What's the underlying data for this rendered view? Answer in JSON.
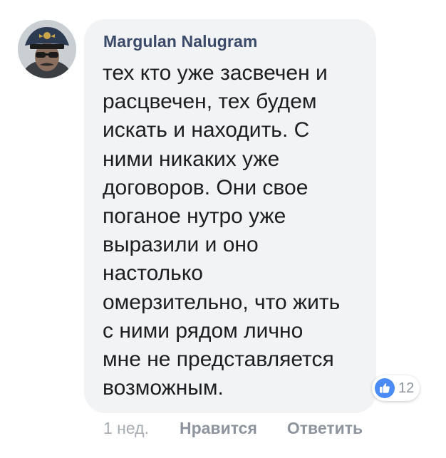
{
  "comment": {
    "author": "Margulan Nalugram",
    "text": "тех кто уже засвечен и\nрасцвечен, тех будем\nискать и находить. С\nними никаких уже\nдоговоров. Они свое\nпоганое нутро уже\nвыразили и оно\nнастолько\nомерзительно, что жить\nс ними рядом лично\nмне не представляется\nвозможным.",
    "reactions": {
      "icon": "thumbs-up-icon",
      "count": "12",
      "icon_color": "#4b8bf5"
    },
    "actions": {
      "timestamp": "1 нед.",
      "like_label": "Нравится",
      "reply_label": "Ответить"
    }
  },
  "colors": {
    "author": "#3b4a69",
    "bubble_bg": "#f2f3f5",
    "text": "#1c1e21",
    "muted": "#8d949e"
  }
}
